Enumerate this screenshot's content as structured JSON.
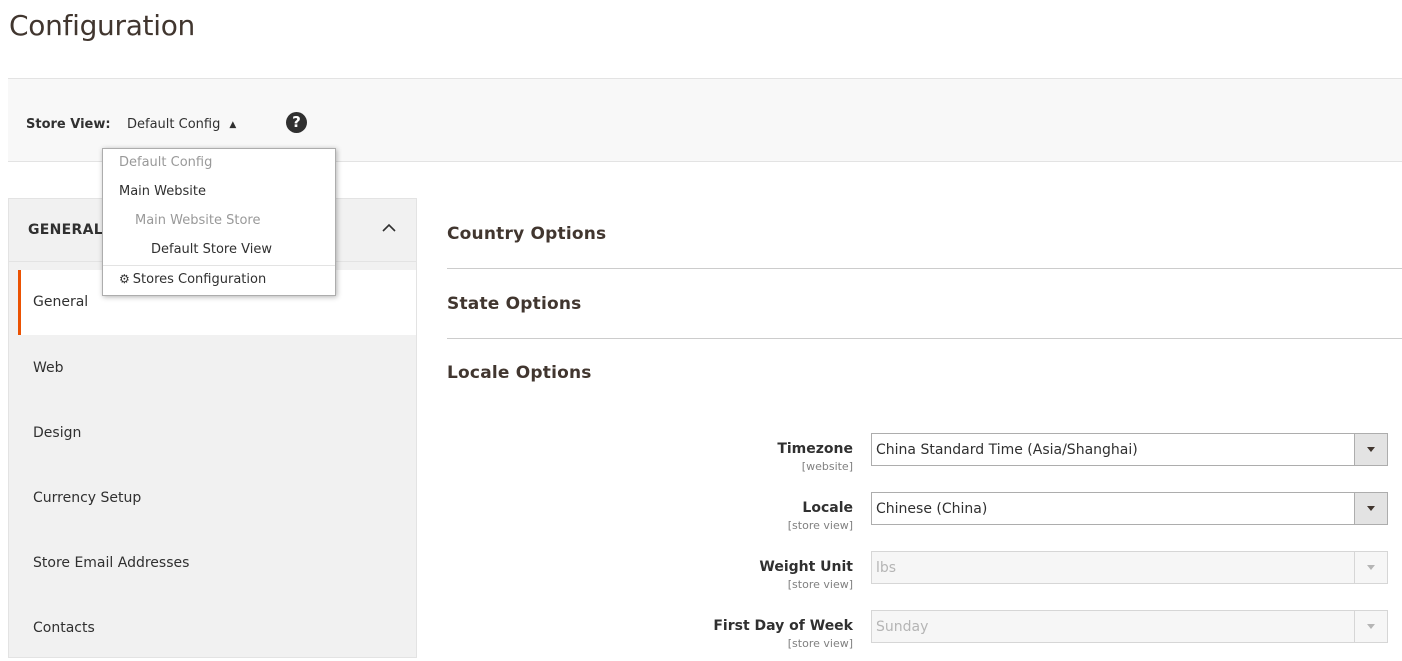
{
  "page": {
    "title": "Configuration"
  },
  "store_switcher": {
    "label": "Store View:",
    "current": "Default Config",
    "dropdown": {
      "default_config": "Default Config",
      "website": "Main Website",
      "store": "Main Website Store",
      "store_view": "Default Store View",
      "stores_configuration": "Stores Configuration"
    }
  },
  "sidebar": {
    "section_title": "GENERAL",
    "items": [
      "General",
      "Web",
      "Design",
      "Currency Setup",
      "Store Email Addresses",
      "Contacts"
    ]
  },
  "main": {
    "sections": [
      "Country Options",
      "State Options",
      "Locale Options"
    ],
    "fields": [
      {
        "label": "Timezone",
        "scope": "[website]",
        "value": "China Standard Time (Asia/Shanghai)"
      },
      {
        "label": "Locale",
        "scope": "[store view]",
        "value": "Chinese (China)"
      },
      {
        "label": "Weight Unit",
        "scope": "[store view]",
        "value": "lbs"
      },
      {
        "label": "First Day of Week",
        "scope": "[store view]",
        "value": "Sunday"
      }
    ]
  },
  "colors": {
    "accent": "#eb5202",
    "sidebar_bg": "#f1f1f1",
    "text": "#303030"
  }
}
